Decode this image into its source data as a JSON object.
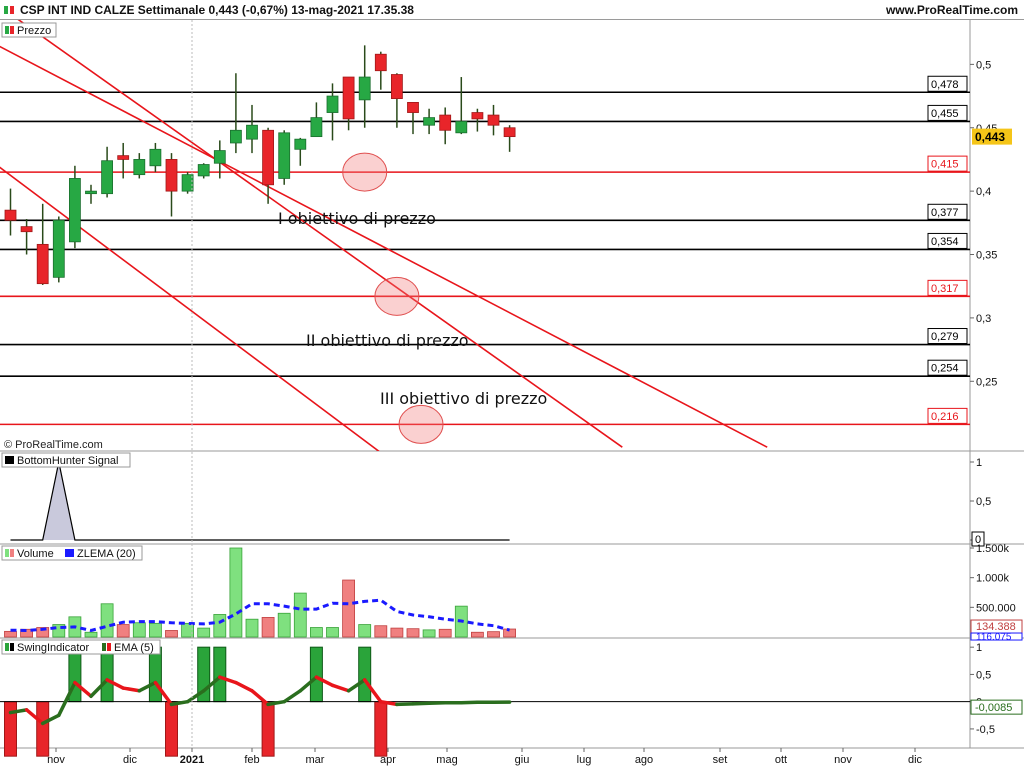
{
  "header": {
    "title": "CSP INT IND CALZE Settimanale 0,443 (-0,67%) 13-mag-2021 17.35.38",
    "site": "www.ProRealTime.com"
  },
  "watermark": "© ProRealTime.com",
  "colors": {
    "up": "#27a844",
    "down": "#e8252a",
    "trendline": "#e8151b",
    "support_black": "#000000",
    "zlema": "#1a1aff",
    "ema": "#e8151b",
    "ema_green": "#2a6e1e",
    "current_price_bg": "#f5c518"
  },
  "x_axis": {
    "labels": [
      "nov",
      "dic",
      "2021",
      "feb",
      "mar",
      "apr",
      "mag",
      "giu",
      "lug",
      "ago",
      "set",
      "ott",
      "nov",
      "dic"
    ]
  },
  "chart_data": [
    {
      "panel": "price",
      "type": "candlestick",
      "legend": "Prezzo",
      "y_ticks": [
        "0,5",
        "0,45",
        "0,4",
        "0,35",
        "0,3",
        "0,25"
      ],
      "y_tick_values": [
        0.5,
        0.45,
        0.4,
        0.35,
        0.3,
        0.25
      ],
      "ylim": [
        0.195,
        0.535
      ],
      "current_price": "0,443",
      "current_price_value": 0.443,
      "candles": [
        {
          "o": 0.385,
          "h": 0.402,
          "l": 0.365,
          "c": 0.377
        },
        {
          "o": 0.372,
          "h": 0.378,
          "l": 0.35,
          "c": 0.368
        },
        {
          "o": 0.358,
          "h": 0.39,
          "l": 0.326,
          "c": 0.327
        },
        {
          "o": 0.332,
          "h": 0.38,
          "l": 0.328,
          "c": 0.377
        },
        {
          "o": 0.36,
          "h": 0.42,
          "l": 0.355,
          "c": 0.41
        },
        {
          "o": 0.398,
          "h": 0.405,
          "l": 0.39,
          "c": 0.4
        },
        {
          "o": 0.398,
          "h": 0.435,
          "l": 0.395,
          "c": 0.424
        },
        {
          "o": 0.428,
          "h": 0.438,
          "l": 0.41,
          "c": 0.425
        },
        {
          "o": 0.413,
          "h": 0.43,
          "l": 0.41,
          "c": 0.425
        },
        {
          "o": 0.42,
          "h": 0.438,
          "l": 0.415,
          "c": 0.433
        },
        {
          "o": 0.425,
          "h": 0.43,
          "l": 0.38,
          "c": 0.4
        },
        {
          "o": 0.4,
          "h": 0.415,
          "l": 0.398,
          "c": 0.413
        },
        {
          "o": 0.412,
          "h": 0.422,
          "l": 0.41,
          "c": 0.421
        },
        {
          "o": 0.422,
          "h": 0.44,
          "l": 0.41,
          "c": 0.432
        },
        {
          "o": 0.438,
          "h": 0.493,
          "l": 0.43,
          "c": 0.448
        },
        {
          "o": 0.441,
          "h": 0.468,
          "l": 0.43,
          "c": 0.452
        },
        {
          "o": 0.448,
          "h": 0.45,
          "l": 0.39,
          "c": 0.405
        },
        {
          "o": 0.41,
          "h": 0.448,
          "l": 0.405,
          "c": 0.446
        },
        {
          "o": 0.433,
          "h": 0.442,
          "l": 0.42,
          "c": 0.441
        },
        {
          "o": 0.443,
          "h": 0.47,
          "l": 0.443,
          "c": 0.458
        },
        {
          "o": 0.462,
          "h": 0.485,
          "l": 0.44,
          "c": 0.475
        },
        {
          "o": 0.49,
          "h": 0.49,
          "l": 0.448,
          "c": 0.457
        },
        {
          "o": 0.472,
          "h": 0.515,
          "l": 0.45,
          "c": 0.49
        },
        {
          "o": 0.508,
          "h": 0.51,
          "l": 0.48,
          "c": 0.495
        },
        {
          "o": 0.492,
          "h": 0.493,
          "l": 0.45,
          "c": 0.473
        },
        {
          "o": 0.47,
          "h": 0.47,
          "l": 0.445,
          "c": 0.462
        },
        {
          "o": 0.452,
          "h": 0.465,
          "l": 0.445,
          "c": 0.458
        },
        {
          "o": 0.46,
          "h": 0.466,
          "l": 0.437,
          "c": 0.448
        },
        {
          "o": 0.446,
          "h": 0.49,
          "l": 0.445,
          "c": 0.455
        },
        {
          "o": 0.462,
          "h": 0.465,
          "l": 0.447,
          "c": 0.457
        },
        {
          "o": 0.46,
          "h": 0.468,
          "l": 0.444,
          "c": 0.452
        },
        {
          "o": 0.45,
          "h": 0.452,
          "l": 0.431,
          "c": 0.443
        }
      ],
      "levels": [
        {
          "label": "0,478",
          "value": 0.478,
          "color": "black"
        },
        {
          "label": "0,455",
          "value": 0.455,
          "color": "black"
        },
        {
          "label": "0,415",
          "value": 0.415,
          "color": "red"
        },
        {
          "label": "0,377",
          "value": 0.377,
          "color": "black"
        },
        {
          "label": "0,354",
          "value": 0.354,
          "color": "black"
        },
        {
          "label": "0,317",
          "value": 0.317,
          "color": "red"
        },
        {
          "label": "0,279",
          "value": 0.279,
          "color": "black"
        },
        {
          "label": "0,254",
          "value": 0.254,
          "color": "black"
        },
        {
          "label": "0,216",
          "value": 0.216,
          "color": "red"
        }
      ],
      "annotations": [
        {
          "text": "I obiettivo di prezzo",
          "target": 0.415
        },
        {
          "text": "II obiettivo di prezzo",
          "target": 0.317
        },
        {
          "text": "III obiettivo di prezzo",
          "target": 0.216
        }
      ]
    },
    {
      "panel": "signal",
      "type": "line",
      "legend": "BottomHunter Signal",
      "y_ticks": [
        "1",
        "0,5",
        "0"
      ],
      "y_tick_values": [
        1,
        0.5,
        0
      ],
      "current_value": "0",
      "values": [
        0,
        0,
        0,
        1,
        0,
        0,
        0,
        0,
        0,
        0,
        0,
        0,
        0,
        0,
        0,
        0,
        0,
        0,
        0,
        0,
        0,
        0,
        0,
        0,
        0,
        0,
        0,
        0,
        0,
        0,
        0,
        0
      ]
    },
    {
      "panel": "volume",
      "type": "bar",
      "legend": [
        "Volume",
        "ZLEMA (20)"
      ],
      "y_ticks": [
        "1.500k",
        "1.000k",
        "500.000"
      ],
      "y_tick_values": [
        1500000,
        1000000,
        500000
      ],
      "current_volume": "134.388",
      "current_zlema": "116.075",
      "volumes": [
        95000,
        130000,
        160000,
        210000,
        340000,
        80000,
        560000,
        210000,
        240000,
        230000,
        110000,
        230000,
        150000,
        380000,
        1500000,
        300000,
        330000,
        400000,
        740000,
        160000,
        160000,
        960000,
        210000,
        190000,
        150000,
        140000,
        120000,
        130000,
        520000,
        80000,
        90000,
        134388
      ],
      "zlema": [
        115000,
        110000,
        130000,
        160000,
        170000,
        110000,
        180000,
        250000,
        260000,
        260000,
        240000,
        230000,
        220000,
        250000,
        390000,
        560000,
        560000,
        520000,
        470000,
        470000,
        570000,
        560000,
        600000,
        620000,
        430000,
        370000,
        340000,
        300000,
        270000,
        220000,
        190000,
        116075
      ]
    },
    {
      "panel": "swing",
      "type": "bar+line",
      "legend": [
        "SwingIndicator",
        "EMA (5)"
      ],
      "y_ticks": [
        "1",
        "0,5",
        "0",
        "-0,5"
      ],
      "y_tick_values": [
        1,
        0.5,
        0,
        -0.5
      ],
      "ylim": [
        -0.85,
        1.15
      ],
      "current_ema": "-0,0085",
      "swing": [
        -1,
        0,
        -1,
        0,
        1,
        0,
        1,
        0,
        0,
        1,
        -1,
        0,
        1,
        1,
        0,
        0,
        -1,
        0,
        0,
        1,
        0,
        0,
        1,
        -1,
        0,
        0,
        0,
        0,
        0,
        0,
        0,
        0
      ],
      "ema": [
        -0.2,
        -0.15,
        -0.4,
        -0.25,
        0.35,
        0.1,
        0.4,
        0.25,
        0.2,
        0.35,
        -0.05,
        0.0,
        0.2,
        0.45,
        0.35,
        0.2,
        -0.05,
        0.0,
        0.2,
        0.45,
        0.3,
        0.2,
        0.4,
        0.0,
        -0.05,
        -0.04,
        -0.03,
        -0.02,
        -0.02,
        -0.01,
        -0.01,
        -0.0085
      ]
    }
  ]
}
